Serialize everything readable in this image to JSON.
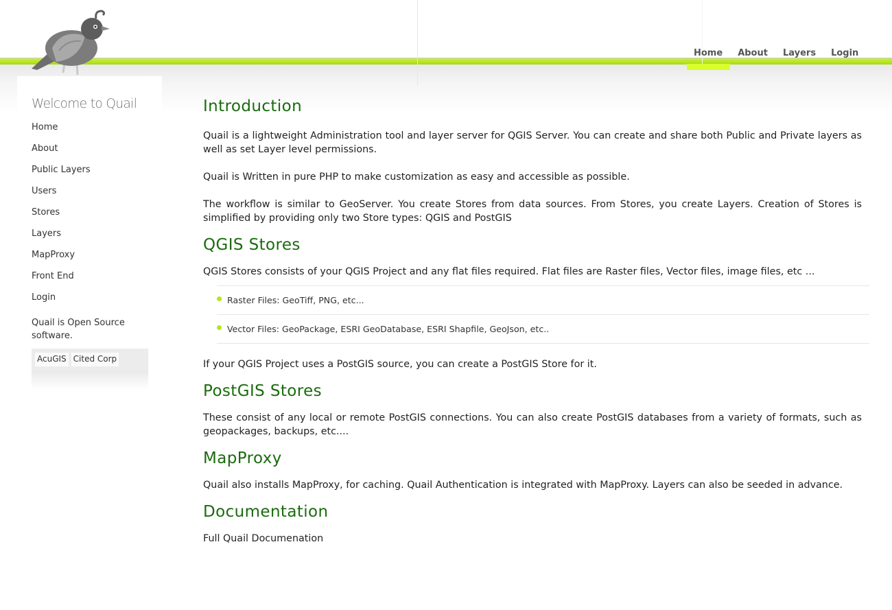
{
  "header": {
    "logo_icon": "quail-bird-logo",
    "accent_color": "#b5e61d",
    "nav": [
      {
        "label": "Home",
        "active": true
      },
      {
        "label": "About",
        "active": false
      },
      {
        "label": "Layers",
        "active": false
      },
      {
        "label": "Login",
        "active": false
      }
    ]
  },
  "sidebar": {
    "title": "Welcome to Quail",
    "menu": [
      "Home",
      "About",
      "Public Layers",
      "Users",
      "Stores",
      "Layers",
      "MapProxy",
      "Front End",
      "Login"
    ],
    "note": "Quail is Open Source software.",
    "tags": [
      "AcuGIS",
      "Cited Corp"
    ]
  },
  "main": {
    "intro_heading": "Introduction",
    "intro_p1": "Quail is a lightweight Administration tool and layer server for QGIS Server. You can create and share both Public and Private layers as well as set Layer level permissions.",
    "intro_p2": "Quail is Written in pure PHP to make customization as easy and accessible as possible.",
    "intro_p3": "The workflow is similar to GeoServer. You create Stores from data sources. From Stores, you create Layers. Creation of Stores is simplified by providing only two Store types: QGIS and PostGIS",
    "qgis_heading": "QGIS Stores",
    "qgis_p1": "QGIS Stores consists of your QGIS Project and any flat files required. Flat files are Raster files, Vector files, image files, etc ...",
    "qgis_bullets": [
      "Raster Files: GeoTiff, PNG, etc...",
      "Vector Files: GeoPackage, ESRI GeoDatabase, ESRI Shapfile, GeoJson, etc.."
    ],
    "qgis_p2": "If your QGIS Project uses a PostGIS source, you can create a PostGIS Store for it.",
    "postgis_heading": "PostGIS Stores",
    "postgis_p1": "These consist of any local or remote PostGIS connections. You can also create PostGIS databases from a variety of formats, such as geopackages, backups, etc....",
    "mapproxy_heading": "MapProxy",
    "mapproxy_p1": "Quail also installs MapProxy, for caching. Quail Authentication is integrated with MapProxy. Layers can also be seeded in advance.",
    "docs_heading": "Documentation",
    "docs_link": "Full Quail Documenation"
  }
}
